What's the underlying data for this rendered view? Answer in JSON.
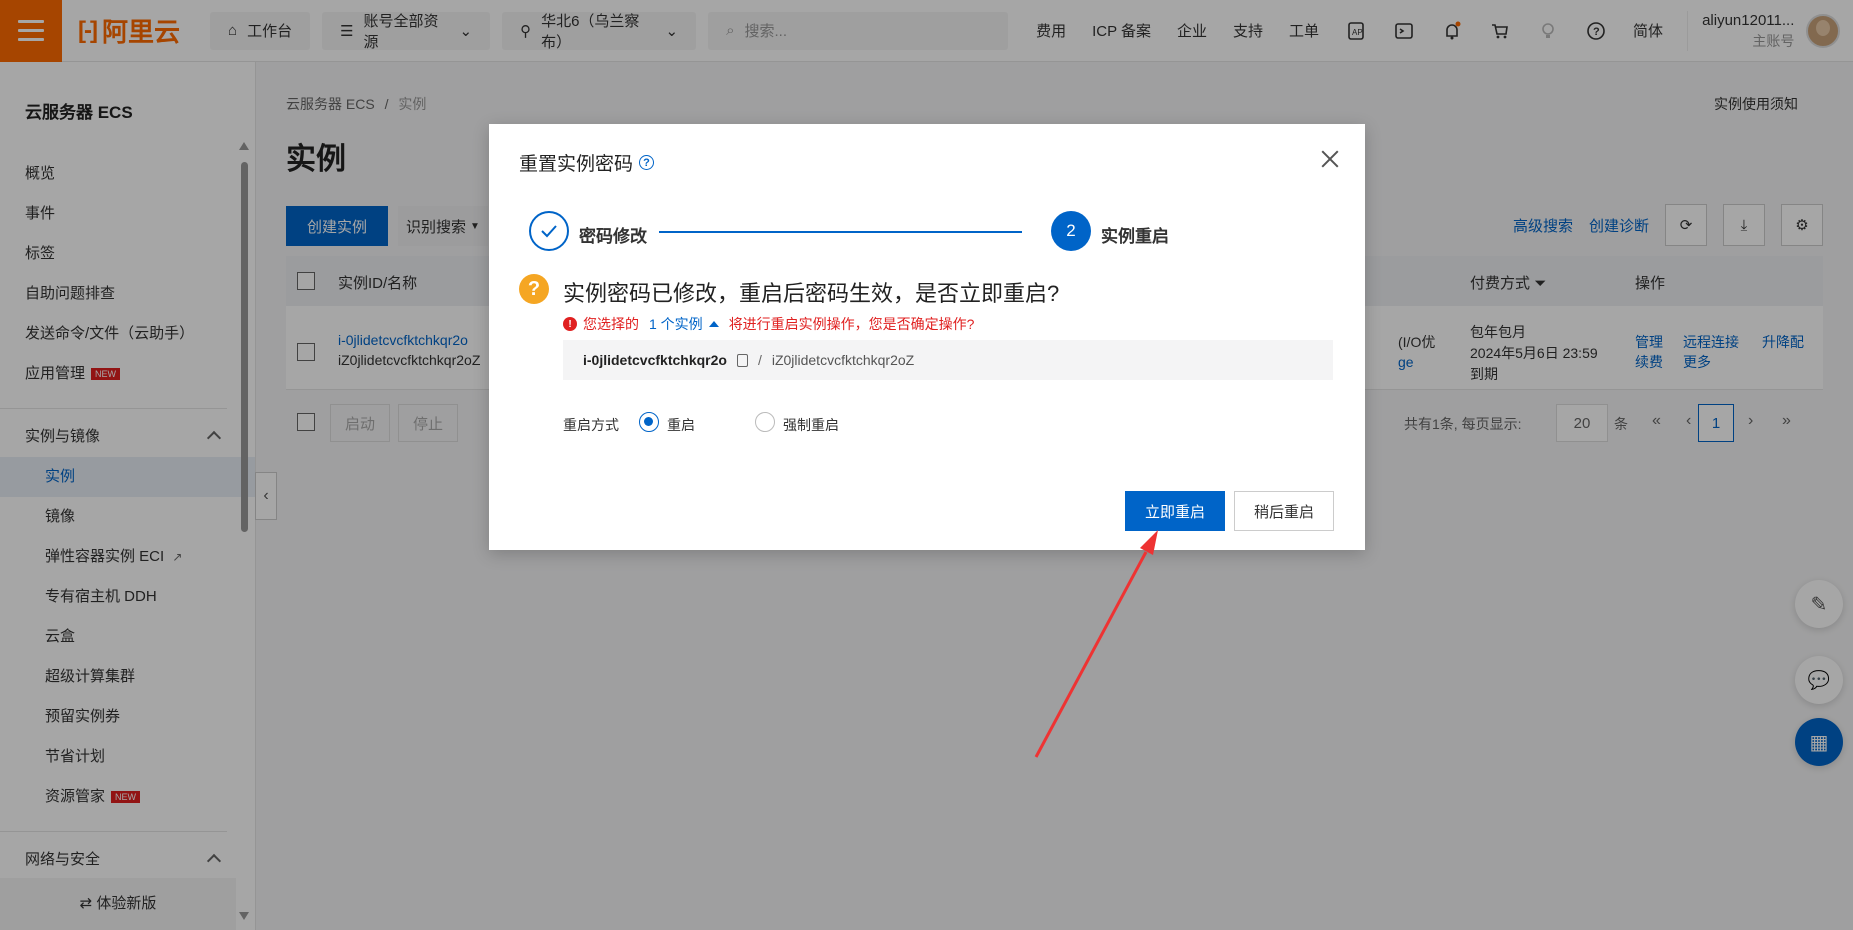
{
  "topbar": {
    "logo_text": "阿里云",
    "workbench": "工作台",
    "resource_scope": "账号全部资源",
    "region": "华北6（乌兰察布）",
    "search_placeholder": "搜索...",
    "links": [
      "费用",
      "ICP 备案",
      "企业",
      "支持",
      "工单"
    ],
    "lang": "简体",
    "user_name": "aliyun12011...",
    "user_type": "主账号"
  },
  "sidebar": {
    "title": "云服务器 ECS",
    "items": [
      "概览",
      "事件",
      "标签",
      "自助问题排查",
      "发送命令/文件（云助手）",
      "应用管理"
    ],
    "new_badge": "NEW",
    "group1": "实例与镜像",
    "group1_items": [
      "实例",
      "镜像",
      "弹性容器实例 ECI",
      "专有宿主机 DDH",
      "云盒",
      "超级计算集群",
      "预留实例券",
      "节省计划",
      "资源管家"
    ],
    "group2": "网络与安全",
    "bottom": "⇄ 体验新版"
  },
  "main": {
    "breadcrumb_root": "云服务器 ECS",
    "breadcrumb_sep": "/",
    "breadcrumb_current": "实例",
    "notice": "实例使用须知",
    "title": "实例",
    "create_btn": "创建实例",
    "recog_btn": "识别搜索",
    "adv_search": "高级搜索",
    "create_diag": "创建诊断",
    "table": {
      "col_id": "实例ID/名称",
      "col_pay": "付费方式",
      "col_ops": "操作",
      "row": {
        "id": "i-0jlidetcvcfktchkqr2o",
        "name": "iZ0jlidetcvcfktchkqr2oZ",
        "spec_frag": "(I/O优",
        "spec_frag2": "ge",
        "pay_type": "包年包月",
        "expire": "2024年5月6日 23:59",
        "expire_suffix": "到期",
        "ops": [
          "管理",
          "远程连接",
          "升降配",
          "续费",
          "更多"
        ]
      }
    },
    "pager": {
      "start": "启动",
      "stop": "停止",
      "summary": "共有1条, 每页显示:",
      "page_size": "20",
      "unit": "条",
      "current_page": "1"
    }
  },
  "dialog": {
    "title": "重置实例密码",
    "step1": "密码修改",
    "step2_num": "2",
    "step2": "实例重启",
    "question": "实例密码已修改，重启后密码生效，是否立即重启?",
    "warn_pre": "您选择的",
    "warn_count": "1 个实例",
    "warn_post": "将进行重启实例操作，您是否确定操作?",
    "instance_id": "i-0jlidetcvcfktchkqr2o",
    "instance_sep": "/",
    "instance_name": "iZ0jlidetcvcfktchkqr2oZ",
    "restart_mode_label": "重启方式",
    "mode_normal": "重启",
    "mode_force": "强制重启",
    "btn_now": "立即重启",
    "btn_later": "稍后重启"
  },
  "colors": {
    "brand": "#ff6a00",
    "primary": "#0064c8",
    "warning": "#f5a623",
    "danger": "#e02020",
    "annotation_arrow": "#ee3333"
  }
}
